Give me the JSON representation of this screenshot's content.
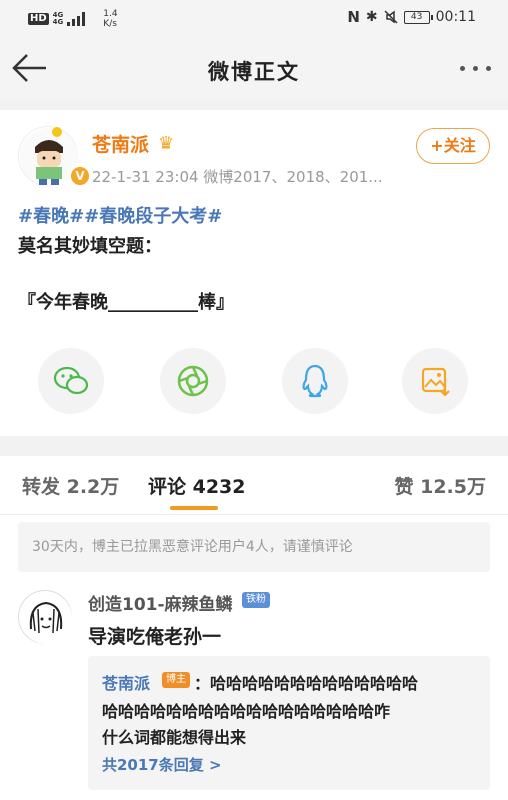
{
  "status_bar": {
    "hd": "HD",
    "net_top": "4G",
    "net_bottom": "4G",
    "speed_value": "1.4",
    "speed_unit": "K/s",
    "battery": "43",
    "time": "00:11"
  },
  "nav": {
    "title": "微博正文"
  },
  "post": {
    "author": "苍南派",
    "meta": "22-1-31 23:04  微博2017、2018、201...",
    "follow_label": "+关注",
    "hashtags": "#春晚##春晚段子大考#",
    "line1": "莫名其妙填空题：",
    "line2": "『今年春晚__________棒』"
  },
  "share_icons": [
    "wechat-icon",
    "moments-icon",
    "qq-icon",
    "save-image-icon"
  ],
  "tabs": {
    "repost": "转发 2.2万",
    "comments": "评论 4232",
    "likes": "赞 12.5万"
  },
  "notice": "30天内，博主已拉黑恶意评论用户4人，请谨慎评论",
  "comment": {
    "author": "创造101-麻辣鱼鳞",
    "badge": "铁粉",
    "text": "导演吃俺老孙一",
    "reply": {
      "author": "苍南派",
      "badge": "博主",
      "line1": "：哈哈哈哈哈哈哈哈哈哈哈哈哈",
      "line2": "哈哈哈哈哈哈哈哈哈哈哈哈哈哈哈哈哈咋",
      "line3": "什么词都能想得出来",
      "more": "共2017条回复 >"
    }
  },
  "colors": {
    "accent_orange": "#f07a12",
    "link_blue": "#4a77b5",
    "tab_underline": "#f39a1e"
  }
}
